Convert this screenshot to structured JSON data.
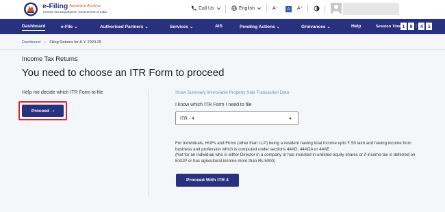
{
  "header": {
    "logo_title": "e-Filing",
    "logo_tagline": "Anywhere Anytime",
    "logo_subtitle": "Income Tax Department, Government of India",
    "call_us": "Call Us",
    "language": "English",
    "font_decrease": "A⁻",
    "font_default": "A",
    "font_increase": "A⁺"
  },
  "nav": {
    "items": [
      "Dashboard",
      "e-File",
      "Authorised Partners",
      "Services",
      "AIS",
      "Pending Actions",
      "Grievances",
      "Help"
    ],
    "active": "Dashboard",
    "session_label": "Session Time",
    "session_digits": [
      "1",
      "9",
      "4",
      "1"
    ]
  },
  "breadcrumb": {
    "home": "Dashboard",
    "current": "Filing Returns for A.Y. 2024-25"
  },
  "page": {
    "subtitle": "Income Tax Returns",
    "title": "You need to choose an ITR Form to proceed"
  },
  "left": {
    "help_text": "Help me decide which ITR Form to file",
    "proceed_label": "Proceed"
  },
  "right": {
    "summary_link": "Show Summary Immovable Property Sale Transaction Data",
    "know_label": "I know which ITR Form I need to file",
    "selected_form": "ITR - 4",
    "description_1": "For Individuals, HUFs and Firms (other than LLP) being a resident having total income upto ₹ 50 lakh and having income from business and profession which is computed under sections 44AD, 44ADA or 44AE",
    "description_2": "(Not for an individual who is either Director in a company or has invested in unlisted equity shares or if income-tax is deferred on ESOP or has agricultural income more than Rs.5000)",
    "proceed_itr_label": "Proceed With ITR 4"
  },
  "colors": {
    "brand_navy": "#27317e",
    "link_blue": "#5b8fd0",
    "highlight_red": "#e0202a",
    "page_bg": "#f5f6f9"
  },
  "icons": [
    "emblem-icon",
    "phone-icon",
    "globe-icon",
    "contrast-icon",
    "user-avatar-icon",
    "chevron-down-icon",
    "chevron-right-icon"
  ]
}
